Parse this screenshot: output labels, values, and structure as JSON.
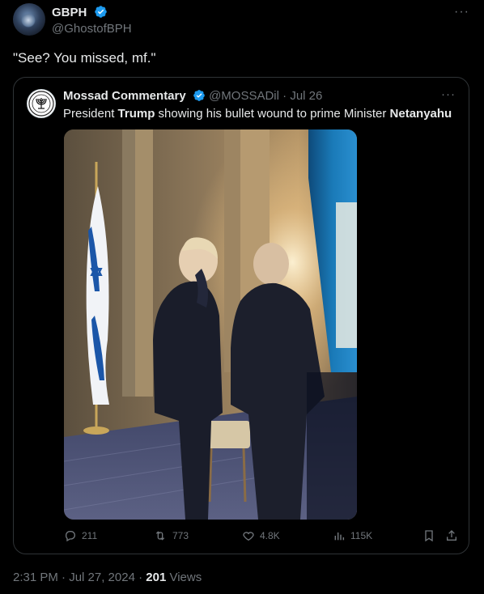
{
  "tweet": {
    "author": {
      "name": "GBPH",
      "handle": "@GhostofBPH",
      "verified": true
    },
    "text": "\"See? You missed, mf.\"",
    "timestamp": "2:31 PM · Jul 27, 2024 · ",
    "views_count": "201",
    "views_label": " Views"
  },
  "quote": {
    "author": {
      "name": "Mossad Commentary",
      "handle": "@MOSSADil",
      "date": "Jul 26",
      "verified": true
    },
    "text_parts": {
      "p1": "President ",
      "b1": "Trump",
      "p2": " showing his bullet wound to prime Minister ",
      "b2": "Netanyahu"
    },
    "stats": {
      "replies": "211",
      "reposts": "773",
      "likes": "4.8K",
      "views": "115K"
    }
  },
  "colors": {
    "background": "#000000",
    "text_primary": "#e7e9ea",
    "text_secondary": "#71767b",
    "verified_blue": "#1d9bf0",
    "border": "#2f3336"
  },
  "icons": [
    "verified-badge-icon",
    "more-icon",
    "reply-icon",
    "repost-icon",
    "like-icon",
    "views-icon",
    "bookmark-icon",
    "share-icon"
  ]
}
